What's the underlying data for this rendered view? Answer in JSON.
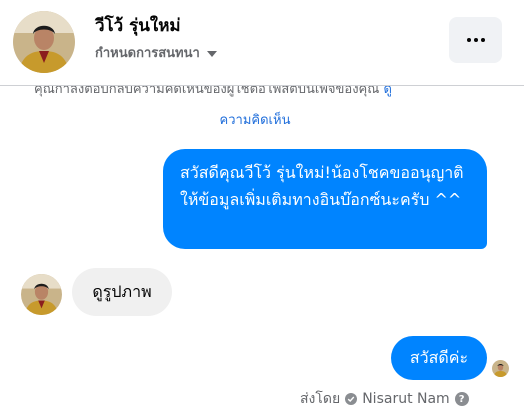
{
  "header": {
    "name": "วีโว้ รุ่นใหม่",
    "subtitle": "กำหนดการสนทนา",
    "more_icon": "more-horizontal-icon"
  },
  "notice": {
    "line1": "คุณกำลังตอบกลับความคิดเห็นของผู้ใช้ต่อโพสต์บนเพจของคุณ",
    "line1_link": "ดู",
    "line2": "ความคิดเห็น"
  },
  "messages": [
    {
      "from": "page",
      "text": "สวัสดีคุณวีโว้ รุ่นใหม่!น้องโชคขออนุญาติให้ข้อมูลเพิ่มเติมทางอินบ๊อกซ์นะครับ ^^"
    },
    {
      "from": "user",
      "text": "ดูรูปภาพ"
    },
    {
      "from": "page",
      "text": "สวัสดีค่ะ"
    }
  ],
  "footer": {
    "sent_by_label": "ส่งโดย",
    "sender": "Nisarut Nam",
    "help_icon": "question-circle-icon"
  },
  "colors": {
    "outgoing_bubble": "#0084ff",
    "incoming_bubble": "#f0f0f0",
    "link": "#216fdb",
    "muted": "#65676b"
  }
}
